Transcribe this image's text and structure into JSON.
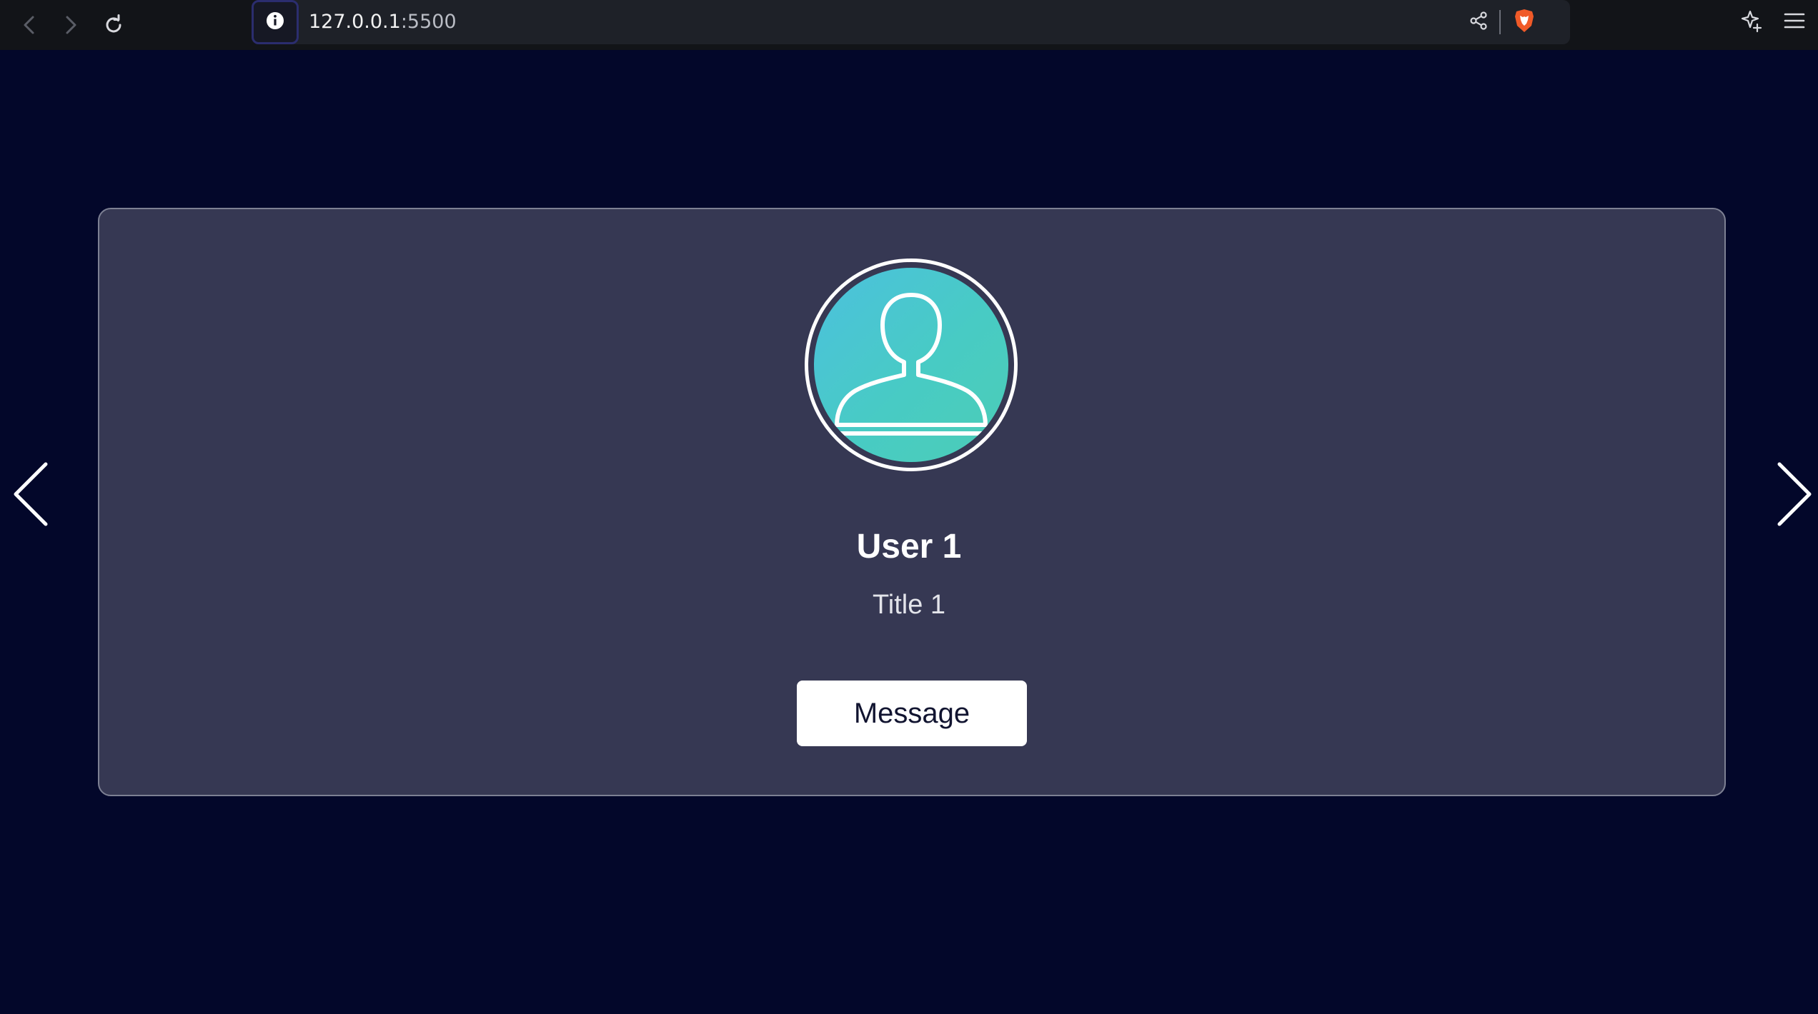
{
  "browser": {
    "url_host": "127.0.0.1",
    "url_port": ":5500",
    "back_icon": "chevron-left-icon",
    "forward_icon": "chevron-right-icon",
    "reload_icon": "reload-icon",
    "site_info_icon": "info-icon",
    "share_icon": "share-icon",
    "brave_icon": "brave-shield-icon",
    "leo_icon": "sparkle-star-icon",
    "menu_icon": "hamburger-menu-icon"
  },
  "card": {
    "avatar_icon": "user-silhouette-icon",
    "name": "User 1",
    "title": "Title 1",
    "message_label": "Message"
  },
  "carousel": {
    "prev_icon": "chevron-left-icon",
    "next_icon": "chevron-right-icon"
  },
  "colors": {
    "page_background": "#03072a",
    "card_background": "#363853",
    "avatar_gradient_start": "#4cc1de",
    "avatar_gradient_end": "#4ccdb6",
    "brave_orange": "#f05a28"
  }
}
